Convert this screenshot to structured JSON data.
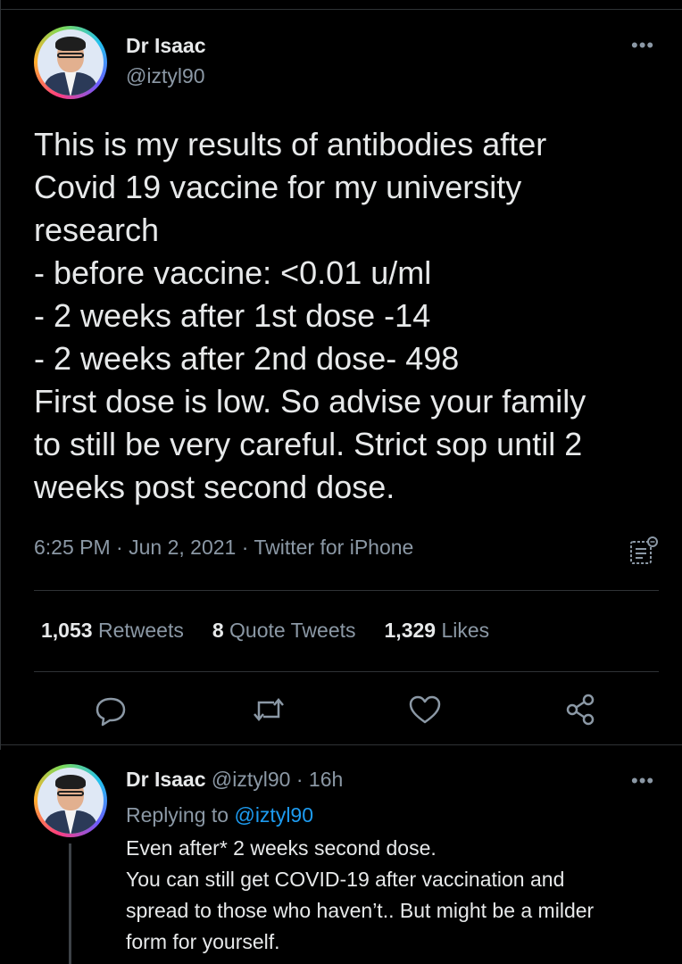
{
  "tweet": {
    "author_name": "Dr Isaac",
    "author_handle": "@iztyl90",
    "more_icon": "more-horizontal-icon",
    "text_lines": [
      "This is my results of antibodies after",
      "Covid 19 vaccine for my university",
      "research",
      "- before vaccine: <0.01 u/ml",
      "- 2 weeks after 1st dose -14",
      "- 2 weeks after 2nd dose- 498",
      "First dose is low. So advise your family",
      "to still be very careful. Strict sop until 2",
      "weeks post second dose."
    ],
    "time": "6:25 PM",
    "date": "Jun 2, 2021",
    "source": "Twitter for iPhone",
    "separator": " · ",
    "analytics_icon": "analytics-icon",
    "stats": {
      "retweets_count": "1,053",
      "retweets_label": "Retweets",
      "quotes_count": "8",
      "quotes_label": "Quote Tweets",
      "likes_count": "1,329",
      "likes_label": "Likes"
    },
    "actions": [
      "reply-icon",
      "retweet-icon",
      "like-icon",
      "share-icon"
    ]
  },
  "reply": {
    "author_name": "Dr Isaac",
    "author_handle": "@iztyl90",
    "time_ago": "16h",
    "separator": " · ",
    "replying_to_label": "Replying to",
    "replying_to_handle": "@iztyl90",
    "text_lines": [
      "Even after* 2 weeks second dose.",
      "You can still get COVID-19 after vaccination and",
      "spread to those who haven’t.. But might be a milder",
      "form for yourself."
    ]
  },
  "colors": {
    "background": "#000000",
    "text": "#e7e9ea",
    "secondary": "#8b98a5",
    "link": "#1d9bf0",
    "divider": "#2f3336"
  }
}
